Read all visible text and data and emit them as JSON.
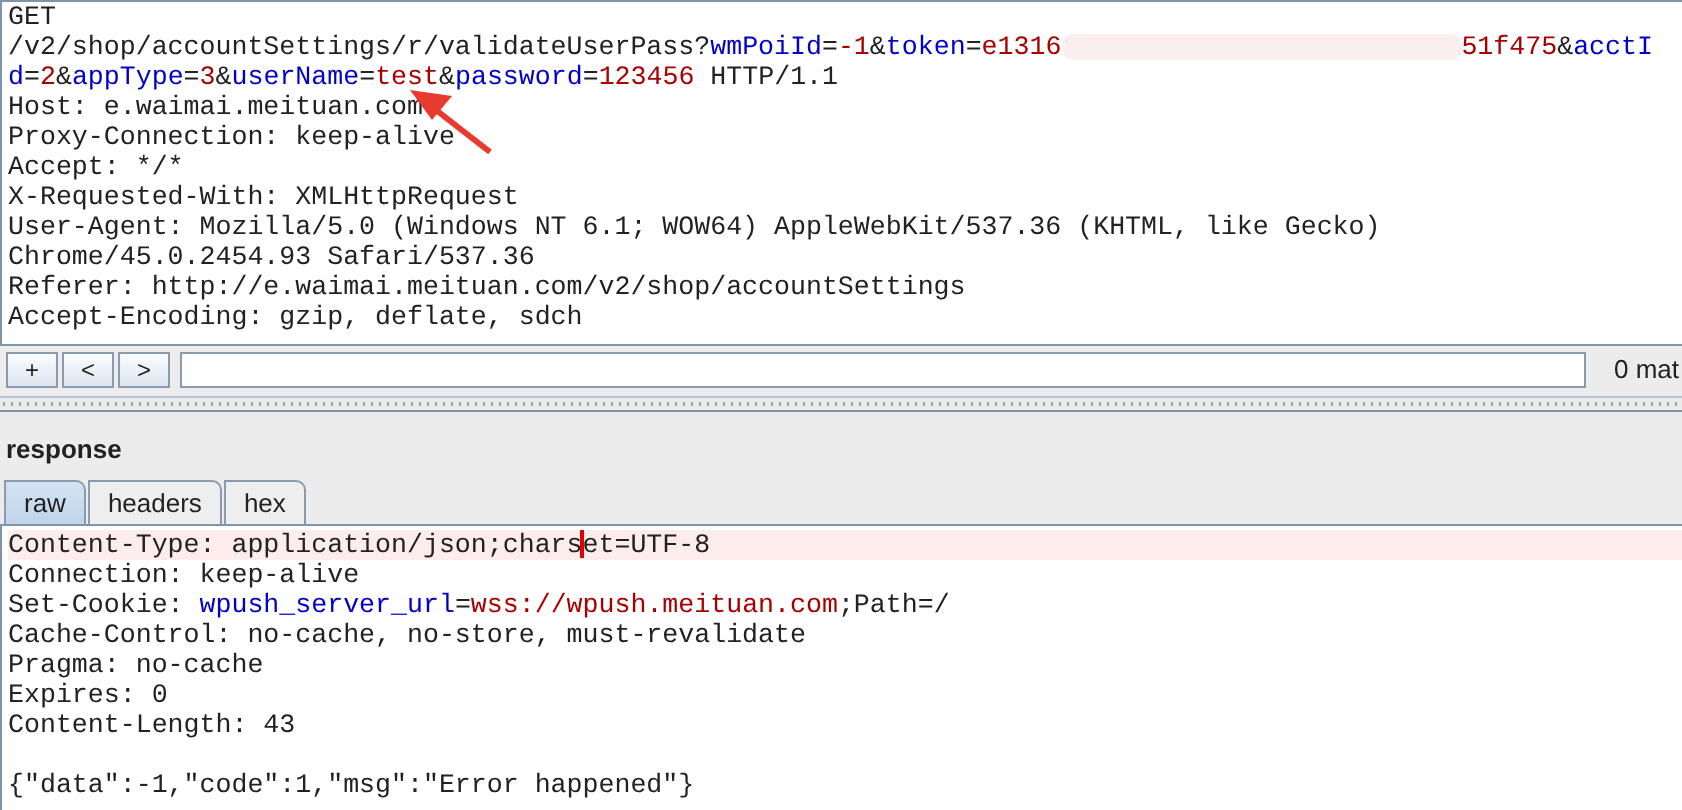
{
  "request": {
    "lines": [
      {
        "kind": "text",
        "segments": [
          {
            "kind": "plain",
            "text": "GET"
          }
        ]
      },
      {
        "kind": "text",
        "segments": [
          {
            "kind": "plain",
            "text": "/v2/shop/accountSettings/r/validateUserPass?"
          },
          {
            "kind": "key",
            "text": "wmPoiId"
          },
          {
            "kind": "plain",
            "text": "="
          },
          {
            "kind": "value",
            "text": "-1"
          },
          {
            "kind": "plain",
            "text": "&"
          },
          {
            "kind": "key",
            "text": "token"
          },
          {
            "kind": "plain",
            "text": "="
          },
          {
            "kind": "value",
            "text": "e1316"
          },
          {
            "kind": "redacted"
          },
          {
            "kind": "value",
            "text": "51f475"
          },
          {
            "kind": "plain",
            "text": "&"
          },
          {
            "kind": "key",
            "text": "acctI"
          }
        ]
      },
      {
        "kind": "text",
        "segments": [
          {
            "kind": "key",
            "text": "d"
          },
          {
            "kind": "plain",
            "text": "="
          },
          {
            "kind": "value",
            "text": "2"
          },
          {
            "kind": "plain",
            "text": "&"
          },
          {
            "kind": "key",
            "text": "appType"
          },
          {
            "kind": "plain",
            "text": "="
          },
          {
            "kind": "value",
            "text": "3"
          },
          {
            "kind": "plain",
            "text": "&"
          },
          {
            "kind": "key",
            "text": "userName"
          },
          {
            "kind": "plain",
            "text": "="
          },
          {
            "kind": "value",
            "text": "test"
          },
          {
            "kind": "plain",
            "text": "&"
          },
          {
            "kind": "key",
            "text": "password"
          },
          {
            "kind": "plain",
            "text": "="
          },
          {
            "kind": "value",
            "text": "123456"
          },
          {
            "kind": "plain",
            "text": " HTTP/1.1"
          }
        ]
      },
      {
        "kind": "text",
        "segments": [
          {
            "kind": "plain",
            "text": "Host: e.waimai.meituan.com"
          }
        ]
      },
      {
        "kind": "text",
        "segments": [
          {
            "kind": "plain",
            "text": "Proxy-Connection: keep-alive"
          }
        ]
      },
      {
        "kind": "text",
        "segments": [
          {
            "kind": "plain",
            "text": "Accept: */*"
          }
        ]
      },
      {
        "kind": "text",
        "segments": [
          {
            "kind": "plain",
            "text": "X-Requested-With: XMLHttpRequest"
          }
        ]
      },
      {
        "kind": "text",
        "segments": [
          {
            "kind": "plain",
            "text": "User-Agent: Mozilla/5.0 (Windows NT 6.1; WOW64) AppleWebKit/537.36 (KHTML, like Gecko)"
          }
        ]
      },
      {
        "kind": "text",
        "segments": [
          {
            "kind": "plain",
            "text": "Chrome/45.0.2454.93 Safari/537.36"
          }
        ]
      },
      {
        "kind": "text",
        "segments": [
          {
            "kind": "plain",
            "text": "Referer: http://e.waimai.meituan.com/v2/shop/accountSettings"
          }
        ]
      },
      {
        "kind": "text",
        "segments": [
          {
            "kind": "plain",
            "text": "Accept-Encoding: gzip, deflate, sdch"
          }
        ]
      }
    ]
  },
  "search_bar": {
    "buttons": [
      "+",
      "<",
      ">"
    ],
    "match_count": "0 mat"
  },
  "response": {
    "title": "response",
    "tabs": [
      {
        "label": "raw",
        "selected": true
      },
      {
        "label": "headers",
        "selected": false
      },
      {
        "label": "hex",
        "selected": false
      }
    ],
    "lines": [
      {
        "kind": "text",
        "highlighted": true,
        "segments": [
          {
            "kind": "plain",
            "text": "Content-Type: application/json;chars"
          },
          {
            "kind": "cursor"
          },
          {
            "kind": "plain",
            "text": "et=UTF-8"
          }
        ]
      },
      {
        "kind": "text",
        "highlighted": false,
        "segments": [
          {
            "kind": "plain",
            "text": "Connection: keep-alive"
          }
        ]
      },
      {
        "kind": "text",
        "highlighted": false,
        "segments": [
          {
            "kind": "plain",
            "text": "Set-Cookie: "
          },
          {
            "kind": "key",
            "text": "wpush_server_url"
          },
          {
            "kind": "plain",
            "text": "="
          },
          {
            "kind": "value",
            "text": "wss://wpush.meituan.com"
          },
          {
            "kind": "plain",
            "text": ";Path=/"
          }
        ]
      },
      {
        "kind": "text",
        "highlighted": false,
        "segments": [
          {
            "kind": "plain",
            "text": "Cache-Control: no-cache, no-store, must-revalidate"
          }
        ]
      },
      {
        "kind": "text",
        "highlighted": false,
        "segments": [
          {
            "kind": "plain",
            "text": "Pragma: no-cache"
          }
        ]
      },
      {
        "kind": "text",
        "highlighted": false,
        "segments": [
          {
            "kind": "plain",
            "text": "Expires: 0"
          }
        ]
      },
      {
        "kind": "text",
        "highlighted": false,
        "segments": [
          {
            "kind": "plain",
            "text": "Content-Length: 43"
          }
        ]
      },
      {
        "kind": "blank"
      },
      {
        "kind": "text",
        "highlighted": false,
        "segments": [
          {
            "kind": "plain",
            "text": "{\"data\":-1,\"code\":1,\"msg\":\"Error happened\"}"
          }
        ]
      }
    ]
  }
}
